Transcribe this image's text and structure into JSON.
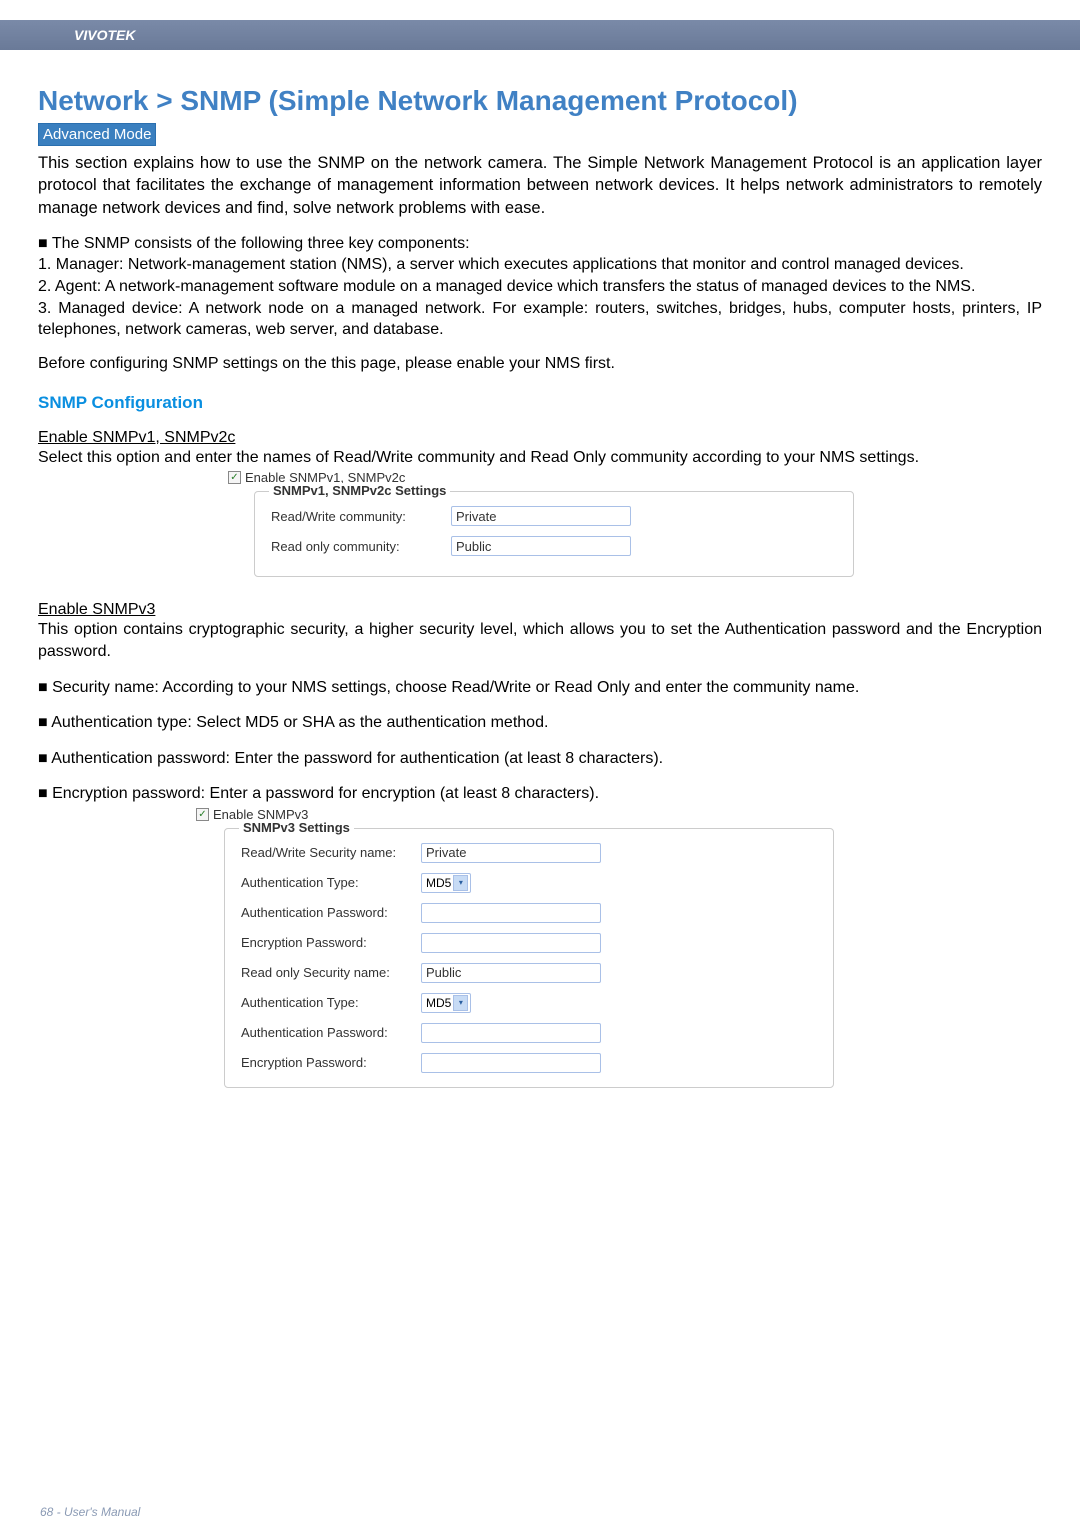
{
  "header": {
    "brand": "VIVOTEK"
  },
  "title": "Network > SNMP (Simple Network Management Protocol)",
  "badge": "Advanced Mode",
  "intro": "This section explains how to use the SNMP on the network camera. The Simple Network Management Protocol is an application layer protocol that facilitates the exchange of management information between network devices. It helps network administrators to remotely manage network devices and find, solve network problems with ease.",
  "components_intro": "■ The SNMP consists of the following three key components:",
  "components": [
    "1. Manager: Network-management station (NMS), a server which executes applications that monitor and control managed devices.",
    "2. Agent: A network-management software module on a managed device which transfers the status of managed devices to the NMS.",
    "3. Managed device: A network node on a managed network. For example: routers, switches, bridges, hubs, computer hosts, printers, IP telephones, network cameras, web server, and database."
  ],
  "before": "Before configuring SNMP settings on the this page, please enable your NMS first.",
  "section_title": "SNMP Configuration",
  "v1v2": {
    "head": "Enable SNMPv1, SNMPv2c",
    "desc": "Select this option and enter the names of Read/Write community and Read Only community according to your NMS settings.",
    "checkbox_label": "Enable SNMPv1, SNMPv2c",
    "legend": "SNMPv1, SNMPv2c Settings",
    "rw_label": "Read/Write community:",
    "rw_value": "Private",
    "ro_label": "Read only community:",
    "ro_value": "Public"
  },
  "v3": {
    "head": "Enable SNMPv3",
    "desc": "This option contains cryptographic security, a higher security level, which allows you to set the Authentication password and the Encryption password.",
    "bullets": [
      "■ Security name: According to your NMS settings, choose Read/Write or Read Only and enter the community name.",
      "■ Authentication type: Select MD5 or SHA as the authentication method.",
      "■ Authentication password: Enter the password for authentication (at least 8 characters).",
      "■ Encryption password: Enter a password for encryption (at least 8 characters)."
    ],
    "checkbox_label": "Enable SNMPv3",
    "legend": "SNMPv3 Settings",
    "rw_sec_label": "Read/Write Security name:",
    "rw_sec_value": "Private",
    "auth_type_label": "Authentication Type:",
    "auth_type_value": "MD5",
    "auth_pw_label": "Authentication Password:",
    "enc_pw_label": "Encryption Password:",
    "ro_sec_label": "Read only Security name:",
    "ro_sec_value": "Public"
  },
  "footer": "68 - User's Manual"
}
